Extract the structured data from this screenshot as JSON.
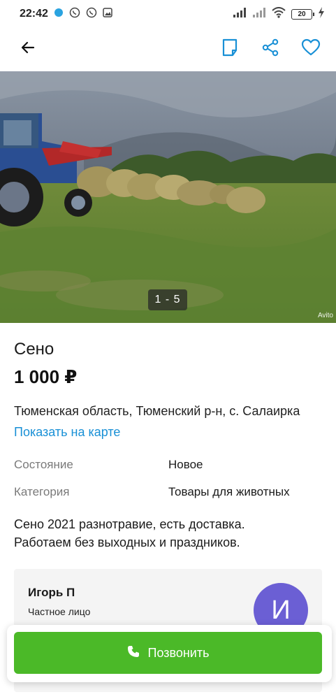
{
  "status_bar": {
    "time": "22:42",
    "battery": "20"
  },
  "app_bar": {
    "icons": [
      "back-arrow-icon",
      "note-icon",
      "share-icon",
      "favorite-heart-icon"
    ]
  },
  "gallery": {
    "counter": "1 - 5",
    "watermark": "Avito"
  },
  "listing": {
    "title": "Сено",
    "price": "1 000 ₽",
    "address": "Тюменская область, Тюменский р-н, с. Салаирка",
    "map_link": "Показать на карте",
    "params": [
      {
        "name": "Состояние",
        "value": "Новое"
      },
      {
        "name": "Категория",
        "value": "Товары для животных"
      }
    ],
    "description": "Сено 2021  разнотравие, есть доставка.\nРаботаем без выходных и праздников."
  },
  "seller": {
    "name": "Игорь П",
    "type": "Частное лицо",
    "avatar_letter": "И"
  },
  "call": {
    "label": "Позвонить"
  },
  "colors": {
    "accent_blue": "#1990d6",
    "call_green": "#4bb928",
    "avatar_purple": "#6b5fd4"
  }
}
